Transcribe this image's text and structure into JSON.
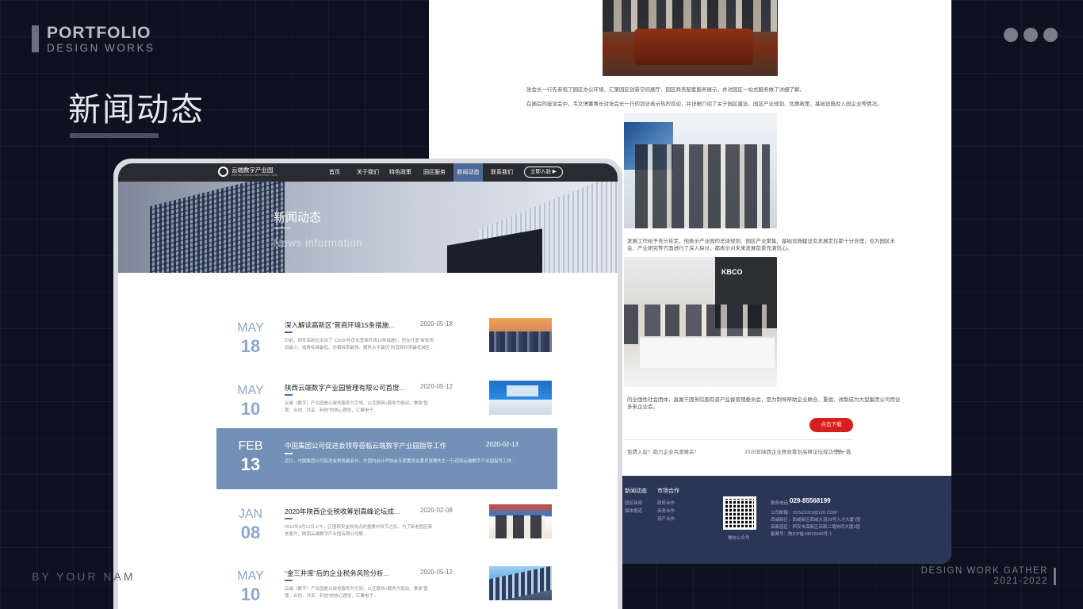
{
  "portfolio": {
    "brand_title": "PORTFOLIO",
    "brand_sub": "DESIGN WORKS",
    "heading": "新闻动态",
    "by_name": "BY YOUR NAM",
    "gather_line1": "DESIGN WORK GATHER",
    "gather_line2": "2021-2022"
  },
  "front": {
    "logo": {
      "name": "云端数字产业园",
      "sub": "DIGITAL CLOUD INDUSTRIAL PARK"
    },
    "nav": [
      "首页",
      "关于我们",
      "特色政策",
      "园区服务",
      "新闻动态",
      "联系我们"
    ],
    "nav_active": "新闻动态",
    "cta": "立即入驻 ▶",
    "banner": {
      "title": "新闻动态",
      "subtitle": "News information"
    },
    "news": [
      {
        "month": "MAY",
        "day": "18",
        "title": "深入解读高新区“营商环境15条措施...",
        "date": "2020-05-18",
        "excerpt": "日前，西安高新区出台了《2020年优化营商环境15条措施》，旨在打造“审批项目最少、收费标准最低、办事效率最快、服务水平最优”的营商环境最优城区..."
      },
      {
        "month": "MAY",
        "day": "10",
        "title": "陕西云端数字产业园管理有限公司首度...",
        "date": "2020-05-12",
        "excerpt": "云端（数字）产业园是以政务服务为引领，以互联网+服务为驱动，秉承“智慧、合创、共享、利他”的核心理念，汇聚电子..."
      },
      {
        "month": "FEB",
        "day": "13",
        "title": "中国集团公司促进会领导莅临云端数字产业园指导工作",
        "date": "2020-02-13",
        "excerpt": "近日，中国集团公司促进会常务副会长、中国内会计师协会专家委员会委员张鹰先生一行莅临云端数字产业园指导工作..."
      },
      {
        "month": "JAN",
        "day": "08",
        "title": "2020年陕西企业税收筹划高峰论坛成...",
        "date": "2020-02-08",
        "excerpt": "2019年9月12日上午，正值西安金秋热点的重要中秋节之际，为了新老园区新老客户，陕西云端数字产业园有限公司联..."
      },
      {
        "month": "MAY",
        "day": "10",
        "title": "“金三井库”后的企业税务风险分析...",
        "date": "2020-05-12",
        "excerpt": "云端（数字）产业园是以政务服务为引领，以互联网+服务为驱动，秉承“智慧、合创、共享、利他”的核心理念，汇聚电子..."
      }
    ]
  },
  "back": {
    "para1": "张会长一行先参观了园区办公环境、汇聚园区创新空间展厅、园区商务配套服务展示，并对园区一站式服务做了详细了解。",
    "para2": "在随后的座谈会中，韦文博董事长对张会长一行的到访表示热烈欢迎，并详细介绍了关于园区建设、园区产业规划、优惠政策、基础设施及入园企业等情况。",
    "para3": "发展工作给予充分肯定，他表示产业园的总体规划、园区产业聚集、基础设施建设及发展定位都十分合理，也为园区未",
    "para4": "会、产业研究等方面进行了深入探讨，都表示对未来发展前景充满信心。",
    "para5": "的全国性社会团体，直属于国务院国有资产监督管理委员会，是为制导帮助企业联合、重组、改制成为大型集团公司而设",
    "para6": "多来企业会。",
    "photo3_logo": "KBCO",
    "download": "点击下载",
    "prev": "免费入驻！助力企业共渡难关！",
    "next_title": "2020年陕西企业税收筹划高峰论坛成功举办",
    "next_label": "下一篇",
    "footer": {
      "col1_title": "新闻动态",
      "col1_items": [
        "园区新闻",
        "媒体报道"
      ],
      "col2_title": "市场合作",
      "col2_items": [
        "政府合作",
        "商务合作",
        "资产合作"
      ],
      "qr_label": "微信公众号",
      "phone_label": "服务电话：",
      "phone": "029-85568199",
      "email": "公司邮箱：YDSZ2019@126.COM",
      "address1": "西咸新区：西咸新区西咸大道29号入才大厦7层",
      "address2": "高新园区：西安市高新区高新二路协同大厦3层",
      "icp": "备案号：陕ICP备19015549号-1"
    }
  }
}
